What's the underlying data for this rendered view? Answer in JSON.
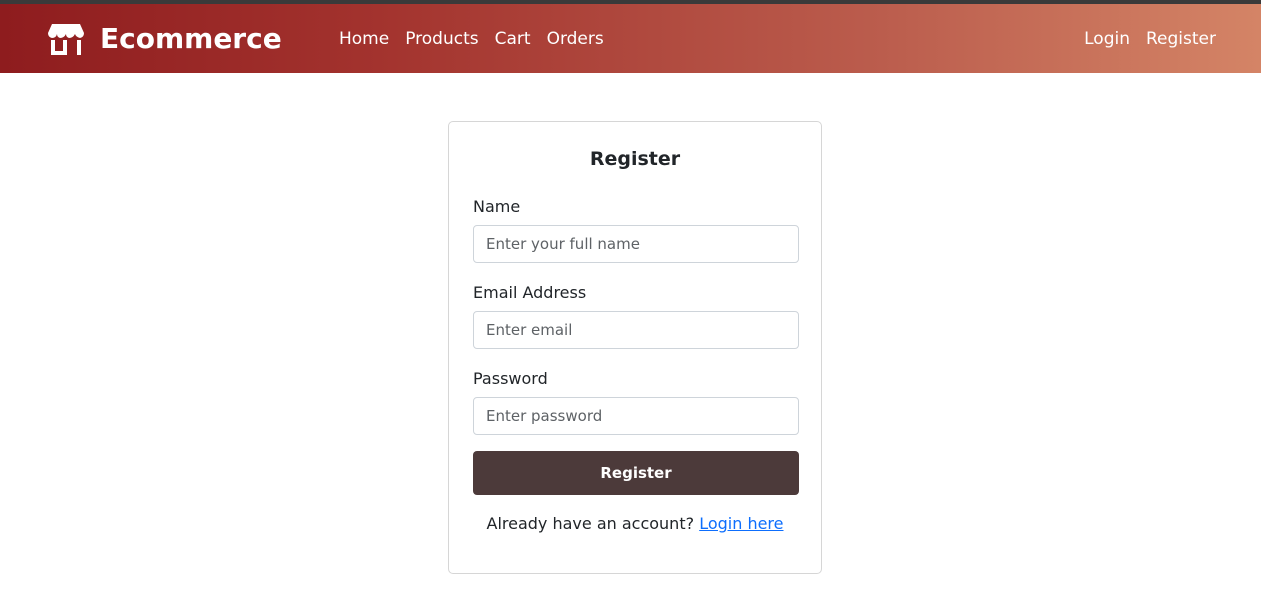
{
  "header": {
    "brand_icon": "store-icon",
    "brand_name": "Ecommerce",
    "nav": [
      {
        "label": "Home"
      },
      {
        "label": "Products"
      },
      {
        "label": "Cart"
      },
      {
        "label": "Orders"
      }
    ],
    "auth": [
      {
        "label": "Login"
      },
      {
        "label": "Register"
      }
    ]
  },
  "form": {
    "title": "Register",
    "name": {
      "label": "Name",
      "value": "",
      "placeholder": "Enter your full name"
    },
    "email": {
      "label": "Email Address",
      "value": "",
      "placeholder": "Enter email"
    },
    "password": {
      "label": "Password",
      "value": "",
      "placeholder": "Enter password"
    },
    "submit_label": "Register",
    "footer_text": "Already have an account?",
    "footer_link": "Login here"
  },
  "colors": {
    "navbar_gradient_start": "#8e1c1e",
    "navbar_gradient_end": "#d48466",
    "button_bg": "#4c3a3a",
    "link": "#0d6efd"
  }
}
